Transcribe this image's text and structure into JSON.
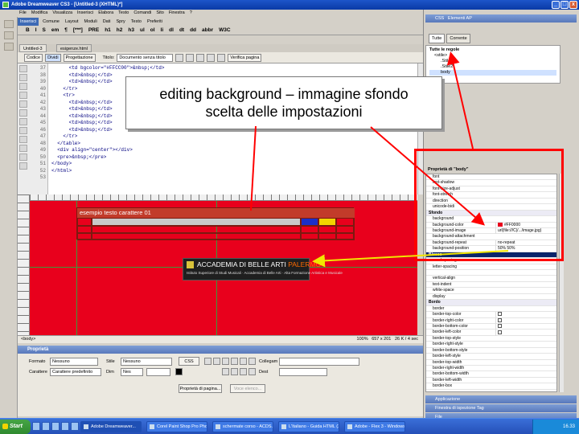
{
  "window": {
    "title": "Adobe Dreamweaver CS3 - [Untitled-3 (XHTML)*]",
    "min_label": "_",
    "max_label": "□",
    "close_label": "x"
  },
  "menubar": [
    "File",
    "Modifica",
    "Visualizza",
    "Inserisci",
    "Elabora",
    "Testo",
    "Comandi",
    "Sito",
    "Finestra",
    "?"
  ],
  "insert_bar": {
    "tabs": [
      "Inserisci",
      "Comune",
      "Layout",
      "Moduli",
      "Dati",
      "Spry",
      "Testo",
      "Preferiti"
    ],
    "buttons": [
      "B",
      "I",
      "S",
      "em",
      "¶",
      "[***]",
      "PRE",
      "h1",
      "h2",
      "h3",
      "ul",
      "ol",
      "li",
      "dl",
      "dt",
      "dd",
      "abbr",
      "W3C"
    ]
  },
  "document_tabs": [
    "Untitled-3",
    "esigenze.html"
  ],
  "view_bar": {
    "code": "Codice",
    "split": "Dividi",
    "design": "Progettazione",
    "title_label": "Titolo:",
    "title_value": "Documento senza titolo",
    "validate": "Verifica pagina"
  },
  "code": {
    "line_numbers": [
      "37",
      "38",
      "39",
      "40",
      "41",
      "42",
      "43",
      "44",
      "45",
      "46",
      "47",
      "48",
      "49",
      "50",
      "51",
      "52",
      "53"
    ],
    "lines": [
      "      <td bgcolor=\"#FFCC00\">&nbsp;</td>",
      "      <td>&nbsp;</td>",
      "      <td>&nbsp;</td>",
      "    </tr>",
      "    <tr>",
      "      <td>&nbsp;</td>",
      "      <td>&nbsp;</td>",
      "      <td>&nbsp;</td>",
      "      <td>&nbsp;</td>",
      "      <td>&nbsp;</td>",
      "    </tr>",
      "  </table>",
      "  <div align=\"center\"></div>",
      "  <pre>&nbsp;</pre>",
      "</body>",
      "</html>",
      ""
    ]
  },
  "design_view": {
    "caption": "esempio testo carattere 01",
    "banner_title_white": "ACCADEMIA DI BELLE ARTI ",
    "banner_title_orange": "PALERMO",
    "banner_subtitle": "Istituto Superiore di Studi Musicali · Accademia di Belle Arti · Alta Formazione Artistica e Musicale",
    "colors": {
      "background": "#e8001c",
      "cell_blue": "#1b2fc8",
      "cell_yellow": "#f2d400"
    }
  },
  "status": {
    "tag": "<body>",
    "zoom": "100%",
    "size": "657 x 201",
    "weight": "26 K / 4 sec"
  },
  "properties_panel": {
    "title": "Proprietà",
    "format_label": "Formato",
    "format_value": "Nessuno",
    "style_label": "Stile",
    "style_value": "Nessuno",
    "css_button": "CSS",
    "font_label": "Carattere",
    "font_value": "Carattere predefinito",
    "size_label": "Dim",
    "size_value": "Nes",
    "link_label": "Collegam",
    "target_label": "Dest",
    "page_props_button": "Proprietà di pagina...",
    "list_item_button": "Voce elenco..."
  },
  "css_panel": {
    "header": "CSS",
    "header_tab2": "Elementi AP",
    "tabs": [
      "Tutte",
      "Corrente"
    ],
    "rules_header": "Tutte le regole",
    "rules": [
      "<stile>",
      "body"
    ],
    "properties_title": "Proprietà di \"body\"",
    "properties": [
      {
        "key": "font",
        "value": ""
      },
      {
        "key": "text-shadow",
        "value": ""
      },
      {
        "key": "font-size-adjust",
        "value": ""
      },
      {
        "key": "font-stretch",
        "value": ""
      },
      {
        "key": "direction",
        "value": ""
      },
      {
        "key": "unicode-bidi",
        "value": ""
      },
      {
        "key": "Sfondo",
        "value": "",
        "category": true
      },
      {
        "key": "background",
        "value": ""
      },
      {
        "key": "background-color",
        "value": "#FF0000",
        "swatch": true
      },
      {
        "key": "background-image",
        "value": "url(file:///C|/.../image.jpg)"
      },
      {
        "key": "background-attachment",
        "value": ""
      },
      {
        "key": "background-repeat",
        "value": "no-repeat"
      },
      {
        "key": "background-position",
        "value": "50% 50%"
      },
      {
        "key": "Blocco",
        "value": "",
        "category": true,
        "highlight": true
      },
      {
        "key": "word-spacing",
        "value": ""
      },
      {
        "key": "letter-spacing",
        "value": ""
      },
      {
        "key": "",
        "value": ""
      },
      {
        "key": "vertical-align",
        "value": ""
      },
      {
        "key": "text-indent",
        "value": ""
      },
      {
        "key": "white-space",
        "value": ""
      },
      {
        "key": "display",
        "value": ""
      },
      {
        "key": "Bordo",
        "value": "",
        "category": true
      },
      {
        "key": "border",
        "value": ""
      },
      {
        "key": "border-top-color",
        "value": "",
        "check": true
      },
      {
        "key": "border-right-color",
        "value": "",
        "check": true
      },
      {
        "key": "border-bottom-color",
        "value": "",
        "check": true
      },
      {
        "key": "border-left-color",
        "value": "",
        "check": true
      },
      {
        "key": "border-top-style",
        "value": ""
      },
      {
        "key": "border-right-style",
        "value": ""
      },
      {
        "key": "border-bottom-style",
        "value": ""
      },
      {
        "key": "border-left-style",
        "value": ""
      },
      {
        "key": "border-top-width",
        "value": ""
      },
      {
        "key": "border-right-width",
        "value": ""
      },
      {
        "key": "border-bottom-width",
        "value": ""
      },
      {
        "key": "border-left-width",
        "value": ""
      },
      {
        "key": "border-box",
        "value": ""
      }
    ],
    "collapsed_panels": [
      "Applicazione",
      "Finestra di ispezione Tag",
      "File"
    ]
  },
  "callout": {
    "line1": "editing background – immagine sfondo",
    "line2": "scelta delle impostazioni"
  },
  "taskbar": {
    "start": "Start",
    "tasks": [
      "Adobe Dreamweaver...",
      "Corel Paint Shop Pro Pho...",
      "schermate corso - ACDS...",
      "L'Italiano - Guida HTML (X...",
      "Adobe - Flex 3 - Windows..."
    ],
    "clock": "16.33"
  },
  "annotation_color": "#ff0000"
}
